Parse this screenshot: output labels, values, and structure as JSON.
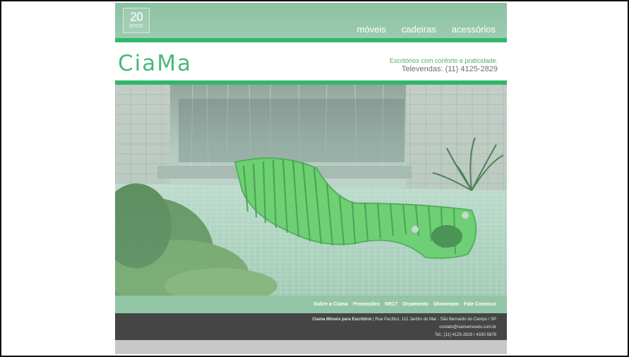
{
  "header": {
    "badge_number": "20",
    "badge_sub": "anos",
    "nav": [
      "móveis",
      "cadeiras",
      "acessórios"
    ]
  },
  "brand": {
    "logo": "CiaMa",
    "tagline": "Escritórios com conforto e praticidade.",
    "phone": "Televendas: (11) 4125-2829"
  },
  "footer": {
    "nav": [
      "Sobre a Ciama",
      "Promoções",
      "NR17",
      "Orçamento",
      "Showroom",
      "Fale Conosco"
    ],
    "company": "Ciama Móveis para Escritório",
    "address": " | Rua Pacífico, 112 Jardim do Mar - São Bernardo do Campo / SP",
    "email": "contato@ciamamoveis.com.br",
    "phones": "Tel.: (11) 4125-2829 / 4330-5878"
  },
  "colors": {
    "accent_green": "#2fb86a",
    "header_green": "#8cc2a2",
    "footer_dark": "#454545"
  },
  "icons": {
    "hero": "green-lounge-chair-photo"
  }
}
